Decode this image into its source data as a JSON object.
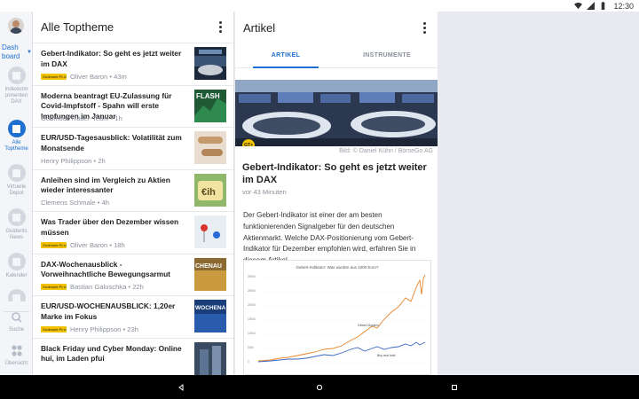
{
  "status_bar": {
    "time": "12:30",
    "icons": [
      "wifi-icon",
      "signal-icon",
      "battery-icon"
    ]
  },
  "rail": {
    "dashboard_label": "Dash board",
    "items": [
      {
        "label": "Indexkom ponenten DAX",
        "icon": "list-icon",
        "active": false
      },
      {
        "label": "Alle Toptheme",
        "icon": "news-icon",
        "active": true
      },
      {
        "label": "Virtuelle Depot",
        "icon": "wallet-icon",
        "active": false
      },
      {
        "label": "Guidants News",
        "icon": "newspaper-icon",
        "active": false
      },
      {
        "label": "Kalender",
        "icon": "calendar-icon",
        "active": false
      },
      {
        "label": "Suche",
        "icon": "search-icon",
        "active": false
      },
      {
        "label": "Übersicht",
        "icon": "grid-icon",
        "active": false
      }
    ]
  },
  "list_panel": {
    "title": "Alle Toptheme",
    "items": [
      {
        "headline": "Gebert-Indikator: So geht es jetzt weiter im DAX",
        "meta": "Oliver Baron • 43m",
        "logo": "Godmode PLUS"
      },
      {
        "headline": "Moderna beantragt EU-Zulassung für Covid-Impfstoff - Spahn will erste Impfungen im Januar",
        "meta": "GodmodeTrader-Team • 1h",
        "logo": ""
      },
      {
        "headline": "EUR/USD-Tagesausblick: Volatilität zum Monatsende",
        "meta": "Henry Philippson • 2h",
        "logo": ""
      },
      {
        "headline": "Anleihen sind im Vergleich zu Aktien wieder interessanter",
        "meta": "Clemens Schmale • 4h",
        "logo": ""
      },
      {
        "headline": "Was Trader über den Dezember wissen müssen",
        "meta": "Oliver Baron • 18h",
        "logo": "Godmode PLUS"
      },
      {
        "headline": "DAX-Wochenausblick - Vorweihnachtliche Bewegungsarmut",
        "meta": "Bastian Galuschka • 22h",
        "logo": "Godmode PLUS"
      },
      {
        "headline": "EUR/USD-WOCHENAUSBLICK: 1,20er Marke im Fokus",
        "meta": "Henry Philippson • 23h",
        "logo": "Godmode PLUS"
      },
      {
        "headline": "Black Friday und Cyber Monday: Online hui, im Laden pfui",
        "meta": "",
        "logo": ""
      }
    ],
    "thumb_texts": {
      "flash": "FLASH",
      "chenau": "CHENAU",
      "wochena": "WOCHENA",
      "coin": "€ih"
    }
  },
  "article_panel": {
    "title": "Artikel",
    "tabs": [
      {
        "label": "ARTIKEL",
        "active": true
      },
      {
        "label": "INSTRUMENTE",
        "active": false
      }
    ],
    "badge": "GT+",
    "image_credit": "Bild: © Daniel Kühn / BörseGo AG",
    "headline": "Gebert-Indikator: So geht es jetzt weiter im DAX",
    "time": "vor 43 Minuten",
    "body": "Der Gebert-Indikator ist einer der am besten funktionierenden Signalgeber für den deutschen Aktienmarkt. Welche DAX-Positionierung vom Gebert-Indikator für Dezember empfohlen wird, erfahren Sie in diesem Artikel.",
    "chart": {
      "title": "Gebert-Indikator: Was wurden aus 1000 Euro?",
      "y_ticks": [
        "30000",
        "25000",
        "20000",
        "15000",
        "10000",
        "5000",
        "0"
      ],
      "series_labels": [
        "Gebert-System",
        "Buy and hold"
      ],
      "colors": {
        "gebert": "#e8872b",
        "buyhold": "#3a66c4"
      }
    }
  },
  "colors": {
    "accent": "#1e6fd0"
  }
}
